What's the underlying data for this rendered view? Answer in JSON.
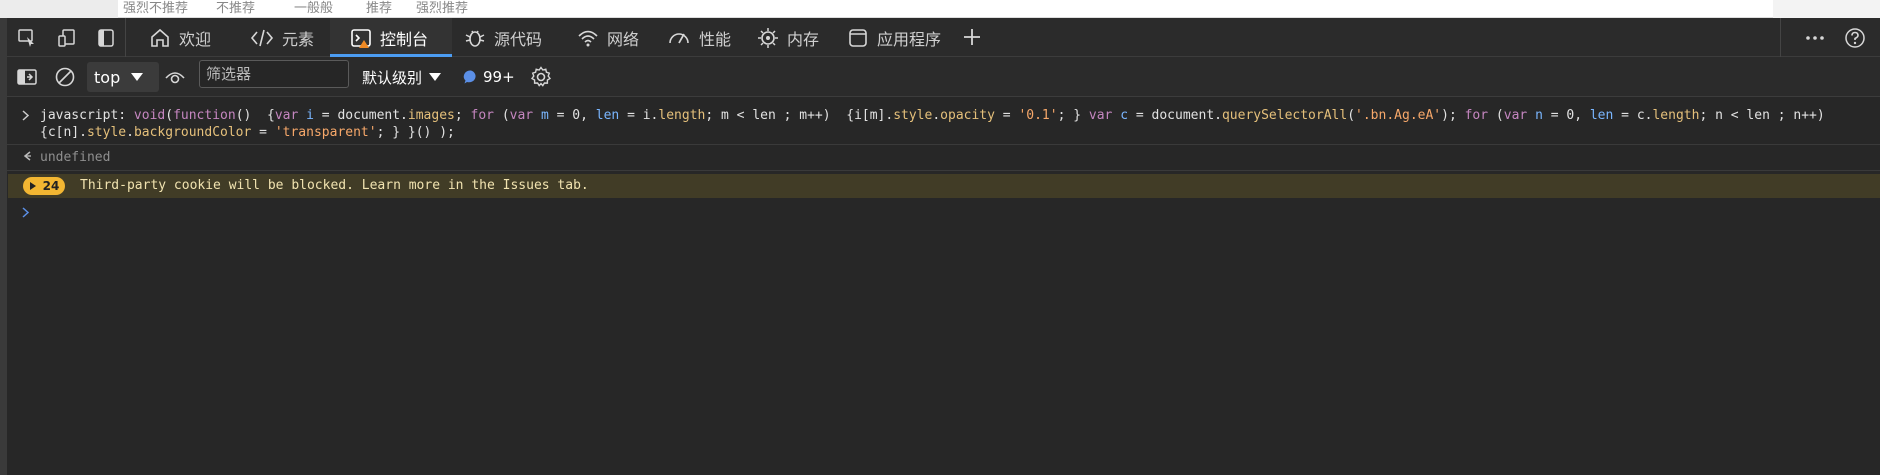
{
  "page_strip": {
    "items": [
      "强烈不推荐",
      "不推荐",
      "一般般",
      "推荐",
      "强烈推荐"
    ]
  },
  "tabs": [
    {
      "label": "欢迎",
      "icon": "home-icon"
    },
    {
      "label": "元素",
      "icon": "code-icon"
    },
    {
      "label": "控制台",
      "icon": "console-icon",
      "active": true
    },
    {
      "label": "源代码",
      "icon": "bug-icon"
    },
    {
      "label": "网络",
      "icon": "wifi-icon"
    },
    {
      "label": "性能",
      "icon": "gauge-icon"
    },
    {
      "label": "内存",
      "icon": "chip-icon"
    },
    {
      "label": "应用程序",
      "icon": "app-icon"
    }
  ],
  "toolbar": {
    "context": "top",
    "filter_placeholder": "筛选器",
    "level": "默认级别",
    "message_count": "99+"
  },
  "console": {
    "input": {
      "p1": "javascript: ",
      "p2": "void",
      "p3": "(",
      "p4": "function",
      "p5": "()  {",
      "p6": "var",
      "p7": " ",
      "p8": "i",
      "p9": " = document.",
      "p10": "images",
      "p11": "; ",
      "p12": "for",
      "p13": " (",
      "p14": "var",
      "p15": " ",
      "p16": "m",
      "p17": " = 0, ",
      "p18": "len",
      "p19": " = i.",
      "p20": "length",
      "p21": "; m < len ; m++)  {i[m].",
      "p22": "style",
      "p23": ".",
      "p24": "opacity",
      "p25": " = ",
      "p26": "'0.1'",
      "p27": "; } ",
      "p28": "var",
      "p29": " ",
      "p30": "c",
      "p31": " = document.",
      "p32": "querySelectorAll",
      "p33": "(",
      "p34": "'.bn.Ag.eA'",
      "p35": "); ",
      "p36": "for",
      "p37": " (",
      "p38": "var",
      "p39": " ",
      "p40": "n",
      "p41": " = 0, ",
      "p42": "len",
      "p43": " = c.",
      "p44": "length",
      "p45": "; n < len ; n++)",
      "q1": "{c[n].",
      "q2": "style",
      "q3": ".",
      "q4": "backgroundColor",
      "q5": " = ",
      "q6": "'transparent'",
      "q7": "; } }() );"
    },
    "result": "undefined",
    "warning": {
      "count": "24",
      "text": "Third-party cookie will be blocked. Learn more in the Issues tab."
    }
  },
  "colors": {
    "accent": "#4c9df3",
    "warning_badge": "#f2b632",
    "warning_bg": "#413c26"
  }
}
